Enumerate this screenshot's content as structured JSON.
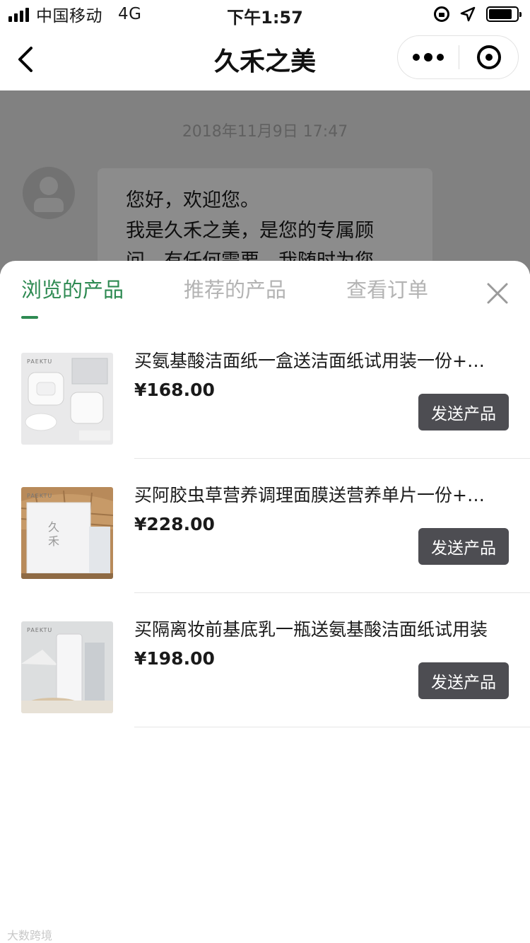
{
  "status_bar": {
    "carrier": "中国移动",
    "network": "4G",
    "time": "下午1:57",
    "battery_level": 0.85,
    "signal_bars": 4
  },
  "nav": {
    "title": "久禾之美"
  },
  "chat": {
    "timestamp": "2018年11月9日 17:47",
    "message_lines": [
      "您好，欢迎您。",
      "我是久禾之美，是您的专属顾",
      "问，有任何需要，我随时为您"
    ]
  },
  "sheet": {
    "tabs": [
      {
        "label": "浏览的产品",
        "active": true
      },
      {
        "label": "推荐的产品",
        "active": false
      },
      {
        "label": "查看订单",
        "active": false
      }
    ],
    "products": [
      {
        "name": "买氨基酸洁面纸一盒送洁面纸试用装一份+…",
        "price": "¥168.00",
        "button": "发送产品",
        "brand": "PAEKTU"
      },
      {
        "name": "买阿胶虫草营养调理面膜送营养单片一份+…",
        "price": "¥228.00",
        "button": "发送产品",
        "brand": "PAEKTU"
      },
      {
        "name": "买隔离妆前基底乳一瓶送氨基酸洁面纸试用装",
        "price": "¥198.00",
        "button": "发送产品",
        "brand": "PAEKTU"
      }
    ]
  },
  "colors": {
    "accent": "#2e8a52",
    "button_bg": "#4d4d52"
  },
  "watermark": "大数跨境"
}
